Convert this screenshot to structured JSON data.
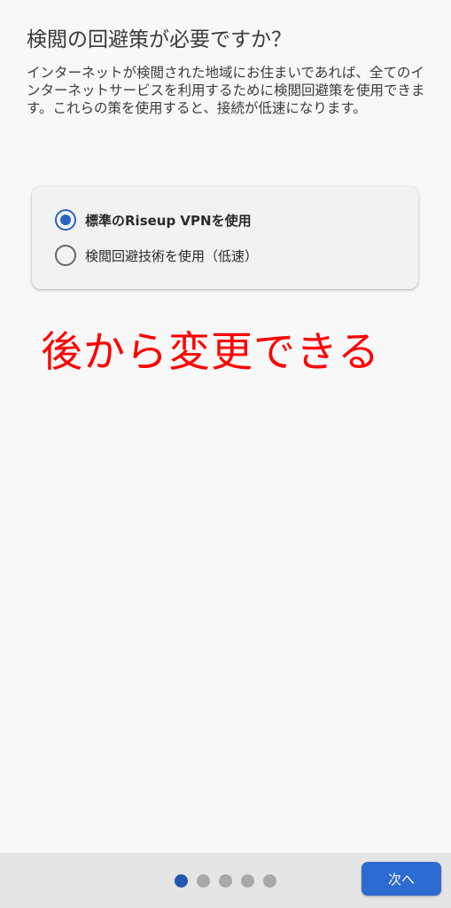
{
  "page": {
    "title": "検閲の回避策が必要ですか？",
    "description": "インターネットが検閲された地域にお住まいであれば、全てのインターネットサービスを利用するために検閲回避策を使用できます。これらの策を使用すると、接続が低速になります。"
  },
  "options": [
    {
      "label": "標準のRiseup VPNを使用",
      "selected": true
    },
    {
      "label": "検閲回避技術を使用（低速）",
      "selected": false
    }
  ],
  "annotation": {
    "text": "後から変更できる",
    "color": "#ff0000"
  },
  "footer": {
    "page_count": 5,
    "current_page": 1,
    "next_label": "次へ"
  },
  "colors": {
    "accent": "#2e6bd1",
    "background": "#f8f8f8"
  }
}
